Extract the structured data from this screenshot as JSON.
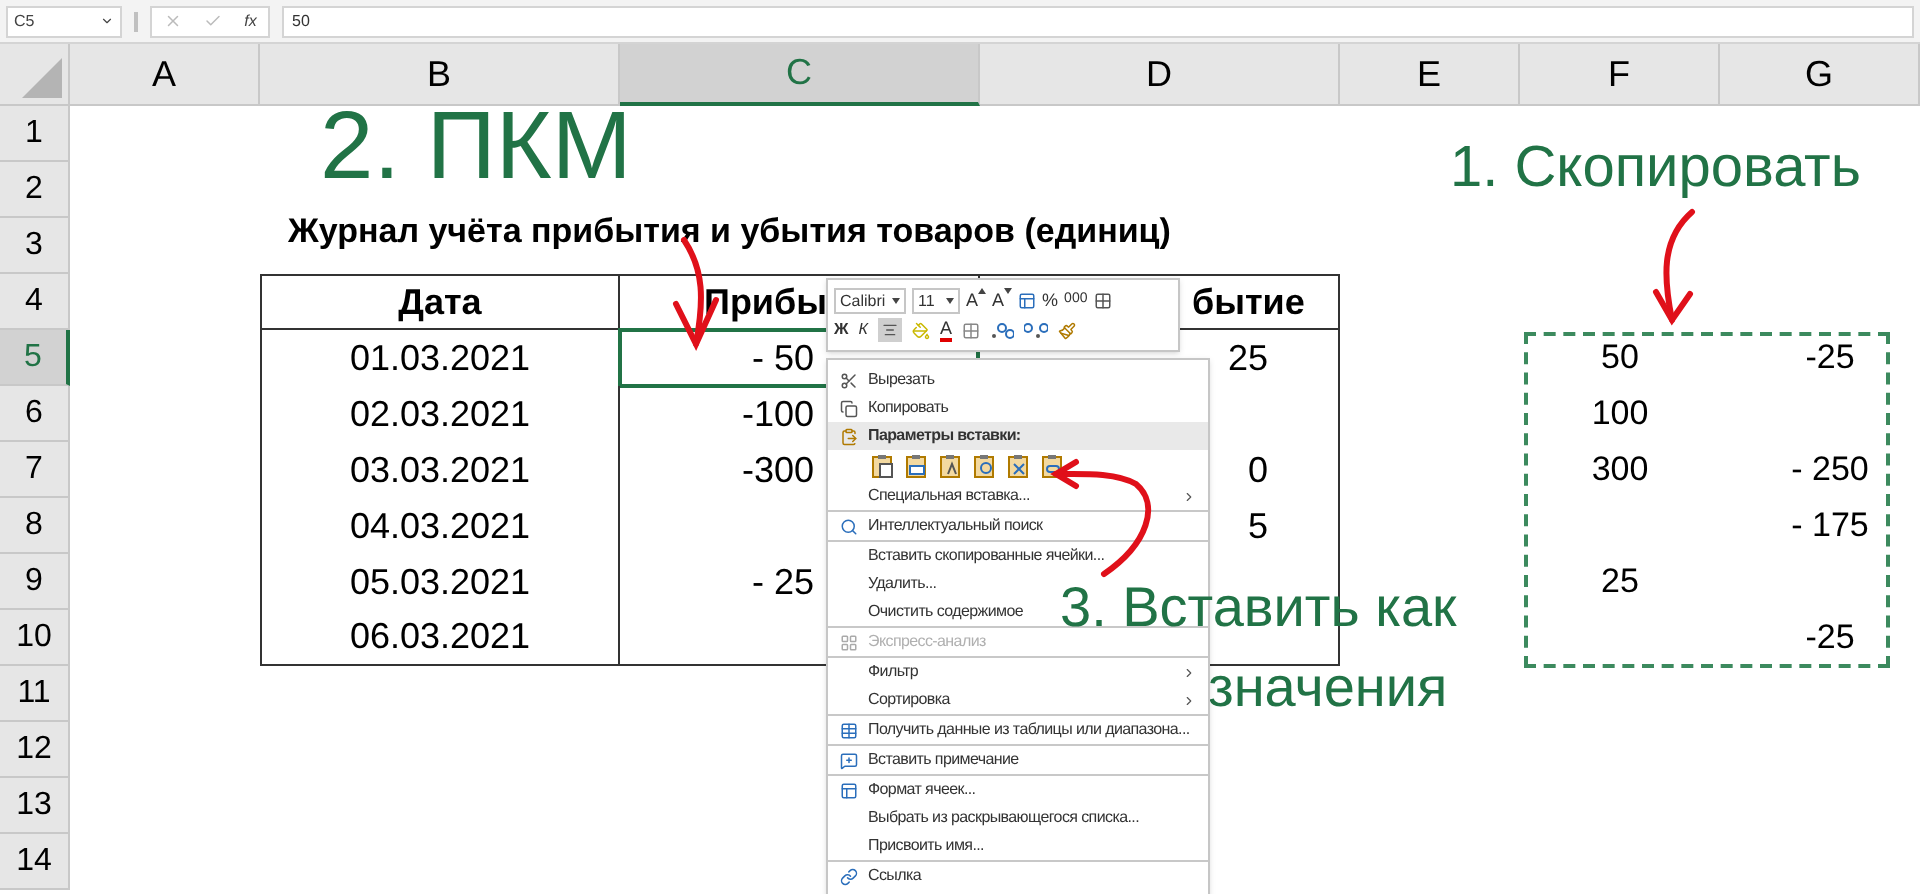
{
  "formula_bar": {
    "name_box": "C5",
    "fx": "fx",
    "value": "50"
  },
  "columns": [
    {
      "label": "A",
      "selected": false
    },
    {
      "label": "B",
      "selected": false
    },
    {
      "label": "C",
      "selected": true
    },
    {
      "label": "D",
      "selected": false
    },
    {
      "label": "E",
      "selected": false
    },
    {
      "label": "F",
      "selected": false
    },
    {
      "label": "G",
      "selected": false
    }
  ],
  "rows": [
    {
      "label": "1",
      "selected": false
    },
    {
      "label": "2",
      "selected": false
    },
    {
      "label": "3",
      "selected": false
    },
    {
      "label": "4",
      "selected": false
    },
    {
      "label": "5",
      "selected": true
    },
    {
      "label": "6",
      "selected": false
    },
    {
      "label": "7",
      "selected": false
    },
    {
      "label": "8",
      "selected": false
    },
    {
      "label": "9",
      "selected": false
    },
    {
      "label": "10",
      "selected": false
    },
    {
      "label": "11",
      "selected": false
    },
    {
      "label": "12",
      "selected": false
    },
    {
      "label": "13",
      "selected": false
    },
    {
      "label": "14",
      "selected": false
    }
  ],
  "sheet_title": "Журнал учёта прибытия и убытия товаров (единиц)",
  "table": {
    "header": [
      "Дата",
      "Прибы",
      "бытие"
    ],
    "rows": [
      {
        "date": "01.03.2021",
        "arrival": "- 50",
        "departure": "25",
        "active": true
      },
      {
        "date": "02.03.2021",
        "arrival": "-100",
        "active": false
      },
      {
        "date": "03.03.2021",
        "arrival": "-300",
        "departure": "0",
        "active": false
      },
      {
        "date": "04.03.2021",
        "departure": "5",
        "active": false
      },
      {
        "date": "05.03.2021",
        "arrival": "- 25",
        "active": false
      },
      {
        "date": "06.03.2021",
        "active": false
      }
    ]
  },
  "copied": [
    {
      "f": "50",
      "g": "-25"
    },
    {
      "f": "100"
    },
    {
      "f": "300",
      "g": "- 250"
    },
    {
      "g": "- 175"
    },
    {
      "f": "25"
    },
    {
      "g": "-25"
    }
  ],
  "annotations": {
    "step1": "1. Скопировать",
    "step2": "2. ПКМ",
    "step3_line1": "3. Вставить как",
    "step3_line2": "значения"
  },
  "mini_toolbar": {
    "font": "Calibri",
    "size": "11",
    "grow": "A",
    "shrink": "A",
    "percent": "%",
    "thousands": "000",
    "bold": "Ж",
    "italic": "К",
    "font_color": "A",
    "align_selected": true
  },
  "context_menu": [
    {
      "kind": "item",
      "label": "Вырезать",
      "submenu": false,
      "disabled": false,
      "separator_before": false
    },
    {
      "kind": "item",
      "label": "Копировать",
      "submenu": false,
      "disabled": false,
      "separator_before": false
    },
    {
      "kind": "header",
      "label": "Параметры вставки:"
    },
    {
      "kind": "paste_options"
    },
    {
      "kind": "item",
      "label": "Специальная вставка...",
      "submenu": true,
      "disabled": false,
      "separator_before": false
    },
    {
      "kind": "item",
      "label": "Интеллектуальный поиск",
      "submenu": false,
      "disabled": false,
      "separator_before": true
    },
    {
      "kind": "item",
      "label": "Вставить скопированные ячейки...",
      "submenu": false,
      "disabled": false,
      "separator_before": true
    },
    {
      "kind": "item",
      "label": "Удалить...",
      "submenu": false,
      "disabled": false,
      "separator_before": false
    },
    {
      "kind": "item",
      "label": "Очистить содержимое",
      "submenu": false,
      "disabled": false,
      "separator_before": false
    },
    {
      "kind": "item",
      "label": "Экспресс-анализ",
      "submenu": false,
      "disabled": true,
      "separator_before": true
    },
    {
      "kind": "item",
      "label": "Фильтр",
      "submenu": true,
      "disabled": false,
      "separator_before": true
    },
    {
      "kind": "item",
      "label": "Сортировка",
      "submenu": true,
      "disabled": false,
      "separator_before": false
    },
    {
      "kind": "item",
      "label": "Получить данные из таблицы или диапазона...",
      "submenu": false,
      "disabled": false,
      "separator_before": true
    },
    {
      "kind": "item",
      "label": "Вставить примечание",
      "submenu": false,
      "disabled": false,
      "separator_before": true
    },
    {
      "kind": "item",
      "label": "Формат ячеек...",
      "submenu": false,
      "disabled": false,
      "separator_before": true
    },
    {
      "kind": "item",
      "label": "Выбрать из раскрывающегося списка...",
      "submenu": false,
      "disabled": false,
      "separator_before": false
    },
    {
      "kind": "item",
      "label": "Присвоить имя...",
      "submenu": false,
      "disabled": false,
      "separator_before": false
    },
    {
      "kind": "item",
      "label": "Ссылка",
      "submenu": false,
      "disabled": false,
      "separator_before": true
    }
  ]
}
